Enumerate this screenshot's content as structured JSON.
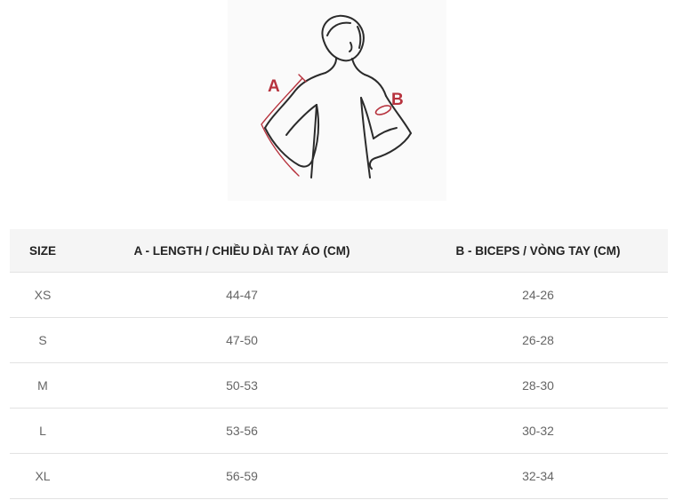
{
  "illustration": {
    "label_a": "A",
    "label_b": "B",
    "accent_color": "#b7323d",
    "line_color": "#2b2b2b"
  },
  "table": {
    "headers": [
      "SIZE",
      "A - LENGTH / CHIỀU DÀI TAY ÁO (CM)",
      "B - BICEPS / VÒNG TAY (CM)"
    ],
    "rows": [
      [
        "XS",
        "44-47",
        "24-26"
      ],
      [
        "S",
        "47-50",
        "26-28"
      ],
      [
        "M",
        "50-53",
        "28-30"
      ],
      [
        "L",
        "53-56",
        "30-32"
      ],
      [
        "XL",
        "56-59",
        "32-34"
      ]
    ]
  }
}
